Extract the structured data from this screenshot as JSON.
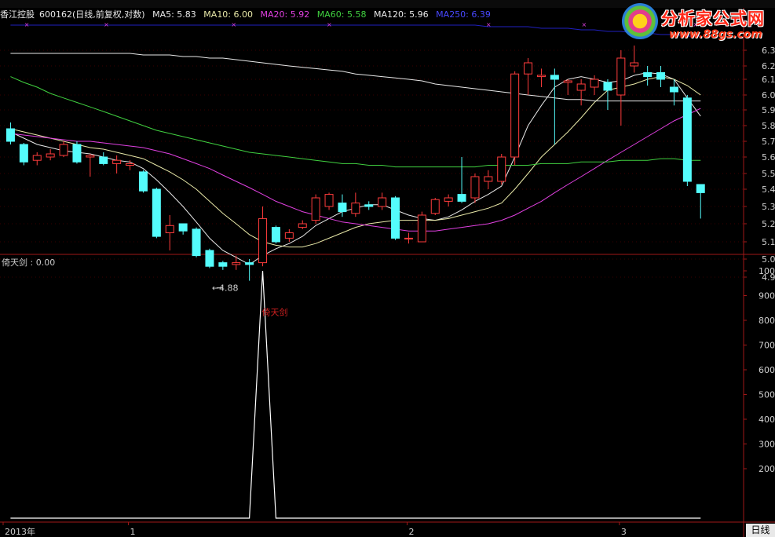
{
  "header": {
    "stock": "香江控股",
    "code": "600162",
    "mode": "(日线,前复权,对数)",
    "ma": [
      {
        "label": "MA5: 5.83",
        "color": "#e8e8e8"
      },
      {
        "label": "MA10: 6.00",
        "color": "#e8e8a8"
      },
      {
        "label": "MA20: 5.92",
        "color": "#e040e0"
      },
      {
        "label": "MA60: 5.58",
        "color": "#40d040"
      },
      {
        "label": "MA120: 5.96",
        "color": "#e8e8e8"
      },
      {
        "label": "MA250: 6.39",
        "color": "#4040ff"
      }
    ]
  },
  "logo": {
    "title": "分析家公式网",
    "url": "www.88gs.com"
  },
  "indicator": {
    "title": "倚天剑 : 0.00",
    "marker_label": "倚天剑"
  },
  "period_tab": "日线",
  "colors": {
    "up": "#ff3c3c",
    "down": "#54fcfc",
    "axis": "#a01818",
    "grid": "#3a0000"
  },
  "chart_data": [
    {
      "type": "candlestick",
      "ylim": [
        4.85,
        6.35
      ],
      "y_ticks": [
        "6.3",
        "6.2",
        "6.1",
        "6.0",
        "5.9",
        "5.8",
        "5.7",
        "5.6",
        "5.5",
        "5.4",
        "5.3",
        "5.2",
        "5.1",
        "5.0",
        "4.9"
      ],
      "y_tick_values": [
        6.3,
        6.2,
        6.1,
        6.0,
        5.9,
        5.8,
        5.7,
        5.6,
        5.5,
        5.4,
        5.3,
        5.2,
        5.1,
        5.0,
        4.9
      ],
      "x_labels": [
        {
          "text": "2013年",
          "i": 0
        },
        {
          "text": "1",
          "i": 9
        },
        {
          "text": "2",
          "i": 30
        },
        {
          "text": "3",
          "i": 46
        }
      ],
      "annotation": {
        "text": "4.88",
        "i": 16,
        "value": 4.88
      },
      "candles": [
        [
          5.78,
          5.7,
          5.82,
          5.68
        ],
        [
          5.68,
          5.57,
          5.69,
          5.55
        ],
        [
          5.58,
          5.61,
          5.63,
          5.55
        ],
        [
          5.6,
          5.62,
          5.65,
          5.58
        ],
        [
          5.61,
          5.68,
          5.7,
          5.6
        ],
        [
          5.68,
          5.57,
          5.7,
          5.56
        ],
        [
          5.6,
          5.61,
          5.62,
          5.48
        ],
        [
          5.6,
          5.56,
          5.63,
          5.55
        ],
        [
          5.56,
          5.58,
          5.61,
          5.5
        ],
        [
          5.55,
          5.56,
          5.58,
          5.52
        ],
        [
          5.51,
          5.39,
          5.52,
          5.38
        ],
        [
          5.4,
          5.13,
          5.41,
          5.12
        ],
        [
          5.15,
          5.19,
          5.25,
          5.05
        ],
        [
          5.2,
          5.16,
          5.2,
          5.14
        ],
        [
          5.17,
          5.02,
          5.18,
          5.01
        ],
        [
          5.05,
          4.96,
          5.06,
          4.95
        ],
        [
          4.98,
          4.96,
          4.99,
          4.94
        ],
        [
          4.97,
          4.98,
          5.02,
          4.94
        ],
        [
          4.98,
          4.97,
          5.0,
          4.88
        ],
        [
          4.98,
          5.23,
          5.3,
          4.96
        ],
        [
          5.18,
          5.1,
          5.19,
          5.09
        ],
        [
          5.12,
          5.15,
          5.17,
          5.1
        ],
        [
          5.18,
          5.2,
          5.22,
          5.17
        ],
        [
          5.22,
          5.35,
          5.37,
          5.2
        ],
        [
          5.3,
          5.37,
          5.38,
          5.28
        ],
        [
          5.32,
          5.27,
          5.37,
          5.24
        ],
        [
          5.26,
          5.32,
          5.38,
          5.24
        ],
        [
          5.31,
          5.3,
          5.33,
          5.28
        ],
        [
          5.3,
          5.35,
          5.38,
          5.28
        ],
        [
          5.35,
          5.12,
          5.36,
          5.11
        ],
        [
          5.12,
          5.12,
          5.15,
          5.09
        ],
        [
          5.1,
          5.25,
          5.27,
          5.1
        ],
        [
          5.26,
          5.34,
          5.35,
          5.25
        ],
        [
          5.33,
          5.35,
          5.37,
          5.3
        ],
        [
          5.37,
          5.33,
          5.6,
          5.32
        ],
        [
          5.35,
          5.48,
          5.5,
          5.32
        ],
        [
          5.45,
          5.48,
          5.52,
          5.4
        ],
        [
          5.45,
          5.6,
          5.62,
          5.43
        ],
        [
          5.6,
          6.14,
          6.16,
          5.55
        ],
        [
          6.14,
          6.22,
          6.25,
          6.0
        ],
        [
          6.12,
          6.13,
          6.18,
          6.05
        ],
        [
          6.13,
          6.1,
          6.18,
          5.68
        ],
        [
          6.08,
          6.09,
          6.1,
          6.0
        ],
        [
          6.03,
          6.07,
          6.1,
          5.93
        ],
        [
          6.05,
          6.1,
          6.13,
          6.0
        ],
        [
          6.08,
          6.03,
          6.1,
          5.9
        ],
        [
          6.0,
          6.25,
          6.3,
          5.8
        ],
        [
          6.2,
          6.22,
          6.33,
          6.15
        ],
        [
          6.15,
          6.12,
          6.2,
          6.06
        ],
        [
          6.15,
          6.1,
          6.2,
          6.05
        ],
        [
          6.05,
          6.02,
          6.1,
          5.93
        ],
        [
          5.98,
          5.45,
          6.0,
          5.42
        ],
        [
          5.43,
          5.38,
          5.43,
          5.23
        ]
      ],
      "ma_series": [
        {
          "name": "MA5",
          "color": "#e8e8e8",
          "start": 0,
          "values": [
            5.76,
            5.72,
            5.68,
            5.66,
            5.64,
            5.63,
            5.62,
            5.6,
            5.58,
            5.57,
            5.53,
            5.46,
            5.38,
            5.3,
            5.21,
            5.12,
            5.05,
            5.01,
            4.97,
            5.02,
            5.06,
            5.09,
            5.13,
            5.19,
            5.23,
            5.27,
            5.29,
            5.31,
            5.31,
            5.28,
            5.25,
            5.23,
            5.22,
            5.24,
            5.28,
            5.33,
            5.37,
            5.42,
            5.6,
            5.8,
            5.93,
            6.05,
            6.1,
            6.12,
            6.1,
            6.08,
            6.09,
            6.13,
            6.15,
            6.14,
            6.1,
            5.98,
            5.86
          ]
        },
        {
          "name": "MA10",
          "color": "#e8e8a8",
          "start": 0,
          "values": [
            5.78,
            5.76,
            5.74,
            5.72,
            5.7,
            5.68,
            5.66,
            5.65,
            5.63,
            5.61,
            5.59,
            5.55,
            5.51,
            5.46,
            5.4,
            5.33,
            5.26,
            5.2,
            5.14,
            5.1,
            5.08,
            5.07,
            5.07,
            5.09,
            5.12,
            5.15,
            5.18,
            5.2,
            5.21,
            5.22,
            5.22,
            5.22,
            5.22,
            5.23,
            5.25,
            5.27,
            5.29,
            5.32,
            5.4,
            5.5,
            5.6,
            5.68,
            5.76,
            5.85,
            5.95,
            6.03,
            6.05,
            6.07,
            6.1,
            6.12,
            6.1,
            6.06,
            6.0
          ]
        },
        {
          "name": "MA20",
          "color": "#e040e0",
          "start": 0,
          "values": [
            5.75,
            5.74,
            5.73,
            5.72,
            5.71,
            5.7,
            5.7,
            5.69,
            5.68,
            5.67,
            5.66,
            5.64,
            5.62,
            5.59,
            5.56,
            5.53,
            5.49,
            5.45,
            5.41,
            5.37,
            5.33,
            5.3,
            5.27,
            5.25,
            5.23,
            5.21,
            5.2,
            5.19,
            5.18,
            5.17,
            5.16,
            5.16,
            5.16,
            5.17,
            5.18,
            5.19,
            5.2,
            5.22,
            5.25,
            5.29,
            5.33,
            5.38,
            5.43,
            5.48,
            5.53,
            5.58,
            5.63,
            5.68,
            5.73,
            5.78,
            5.83,
            5.87,
            5.91
          ]
        },
        {
          "name": "MA60",
          "color": "#40d040",
          "start": 0,
          "values": [
            6.12,
            6.08,
            6.05,
            6.01,
            5.98,
            5.95,
            5.92,
            5.89,
            5.86,
            5.83,
            5.8,
            5.77,
            5.75,
            5.73,
            5.71,
            5.69,
            5.67,
            5.65,
            5.63,
            5.62,
            5.61,
            5.6,
            5.59,
            5.58,
            5.57,
            5.56,
            5.56,
            5.55,
            5.55,
            5.54,
            5.54,
            5.54,
            5.54,
            5.54,
            5.54,
            5.54,
            5.55,
            5.55,
            5.55,
            5.55,
            5.56,
            5.56,
            5.56,
            5.57,
            5.57,
            5.57,
            5.58,
            5.58,
            5.58,
            5.59,
            5.59,
            5.58,
            5.58
          ]
        },
        {
          "name": "MA120",
          "color": "#e8e8e8",
          "start": 0,
          "values": [
            6.28,
            6.28,
            6.28,
            6.28,
            6.28,
            6.28,
            6.28,
            6.28,
            6.28,
            6.28,
            6.27,
            6.27,
            6.27,
            6.26,
            6.26,
            6.25,
            6.25,
            6.24,
            6.23,
            6.22,
            6.21,
            6.2,
            6.19,
            6.18,
            6.17,
            6.16,
            6.14,
            6.13,
            6.12,
            6.11,
            6.1,
            6.09,
            6.07,
            6.06,
            6.05,
            6.04,
            6.03,
            6.02,
            6.01,
            6.0,
            5.99,
            5.98,
            5.97,
            5.97,
            5.96,
            5.96,
            5.96,
            5.96,
            5.96,
            5.96,
            5.96,
            5.96,
            5.96
          ]
        },
        {
          "name": "MA250",
          "color": "#2020c0",
          "start": 0,
          "values": [
            6.46,
            6.46,
            6.46,
            6.46,
            6.46,
            6.46,
            6.46,
            6.46,
            6.46,
            6.46,
            6.46,
            6.46,
            6.46,
            6.46,
            6.46,
            6.46,
            6.46,
            6.46,
            6.46,
            6.46,
            6.46,
            6.46,
            6.46,
            6.46,
            6.46,
            6.46,
            6.46,
            6.46,
            6.46,
            6.46,
            6.46,
            6.46,
            6.46,
            6.46,
            6.46,
            6.46,
            6.45,
            6.45,
            6.45,
            6.45,
            6.44,
            6.44,
            6.44,
            6.43,
            6.43,
            6.42,
            6.42,
            6.41,
            6.41,
            6.4,
            6.4,
            6.39,
            6.39
          ]
        }
      ]
    },
    {
      "type": "line",
      "title": "倚天剑",
      "ylim": [
        0,
        1000
      ],
      "y_ticks": [
        "100",
        "900",
        "800",
        "700",
        "600",
        "500",
        "400",
        "300",
        "200"
      ],
      "y_tick_values": [
        1000,
        900,
        800,
        700,
        600,
        500,
        400,
        300,
        200
      ],
      "values": [
        0,
        0,
        0,
        0,
        0,
        0,
        0,
        0,
        0,
        0,
        0,
        0,
        0,
        0,
        0,
        0,
        0,
        0,
        0,
        1000,
        0,
        0,
        0,
        0,
        0,
        0,
        0,
        0,
        0,
        0,
        0,
        0,
        0,
        0,
        0,
        0,
        0,
        0,
        0,
        0,
        0,
        0,
        0,
        0,
        0,
        0,
        0,
        0,
        0,
        0,
        0,
        0,
        0
      ]
    }
  ]
}
